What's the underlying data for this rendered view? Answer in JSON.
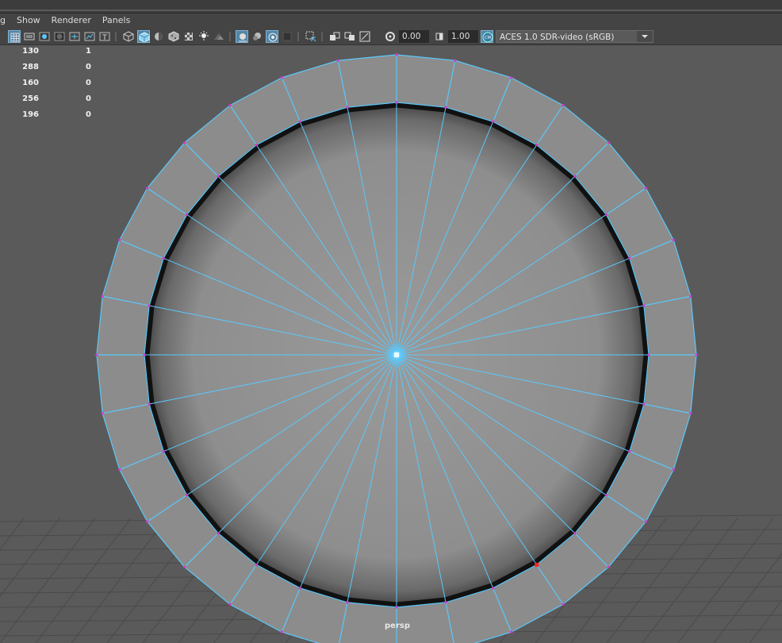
{
  "menu": {
    "items": [
      "g",
      "Show",
      "Renderer",
      "Panels"
    ]
  },
  "toolbar": {
    "exposure_value": "0.00",
    "gamma_value": "1.00",
    "view_transform": "ACES 1.0 SDR-video (sRGB)",
    "icons": [
      "grid-icon",
      "film-gate-icon",
      "resolution-gate-icon",
      "gate-mask-icon",
      "field-chart-icon",
      "safe-action-icon",
      "safe-title-icon",
      "wireframe-icon",
      "smooth-shade-icon",
      "default-material-icon",
      "textured-icon",
      "use-all-lights-icon",
      "shadows-icon",
      "screen-space-ao-icon",
      "motion-blur-icon",
      "multisample-aa-icon",
      "depth-of-field-icon",
      "isolate-select-icon",
      "xray-icon",
      "xray-active-components-icon",
      "xray-joints-icon",
      "exposure-icon",
      "gamma-icon",
      "color-management-icon"
    ]
  },
  "hud": {
    "rows": [
      {
        "a": "130",
        "b": "1"
      },
      {
        "a": "288",
        "b": "0"
      },
      {
        "a": "160",
        "b": "0"
      },
      {
        "a": "256",
        "b": "0"
      },
      {
        "a": "196",
        "b": "0"
      }
    ]
  },
  "viewport": {
    "camera_label": "persp",
    "colors": {
      "background": "#5a5a5a",
      "grid": "#4a4a4a",
      "face": "#8c8c8c",
      "wire": "#5ac8fa",
      "vertex": "#d03ad0",
      "selected_vertex": "#ff2020"
    }
  }
}
